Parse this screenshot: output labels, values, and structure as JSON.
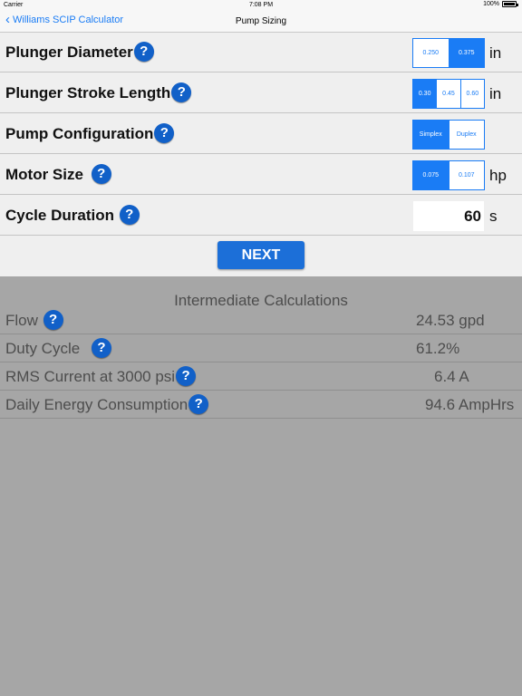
{
  "status_bar": {
    "carrier": "Carrier",
    "time": "7:08 PM",
    "battery": "100%"
  },
  "nav": {
    "back_label": "Williams SCIP Calculator",
    "title": "Pump Sizing"
  },
  "form": {
    "plunger_diameter": {
      "label": "Plunger Diameter",
      "options": [
        "0.250",
        "0.375"
      ],
      "selected": "0.375",
      "unit": "in"
    },
    "plunger_stroke": {
      "label": "Plunger Stroke Length",
      "options": [
        "0.30",
        "0.45",
        "0.60"
      ],
      "selected": "0.30",
      "unit": "in"
    },
    "pump_config": {
      "label": "Pump Configuration",
      "options": [
        "Simplex",
        "Duplex"
      ],
      "selected": "Simplex"
    },
    "motor_size": {
      "label": "Motor Size",
      "options": [
        "0.075",
        "0.107"
      ],
      "selected": "0.075",
      "unit": "hp"
    },
    "cycle_duration": {
      "label": "Cycle Duration",
      "value": "60",
      "unit": "s"
    },
    "help_glyph": "?"
  },
  "next_button": "NEXT",
  "calculations": {
    "title": "Intermediate Calculations",
    "flow": {
      "label": "Flow",
      "value": "24.53 gpd"
    },
    "duty_cycle": {
      "label": "Duty Cycle",
      "value": "61.2%"
    },
    "rms_current": {
      "label": "RMS Current at 3000 psi",
      "value": "6.4 A"
    },
    "daily_energy": {
      "label": "Daily Energy Consumption",
      "value": "94.6 AmpHrs"
    }
  },
  "colors": {
    "accent": "#1a7cf5",
    "help_button": "#1160c8",
    "form_bg": "#efefef",
    "calc_bg": "#a6a6a6"
  }
}
